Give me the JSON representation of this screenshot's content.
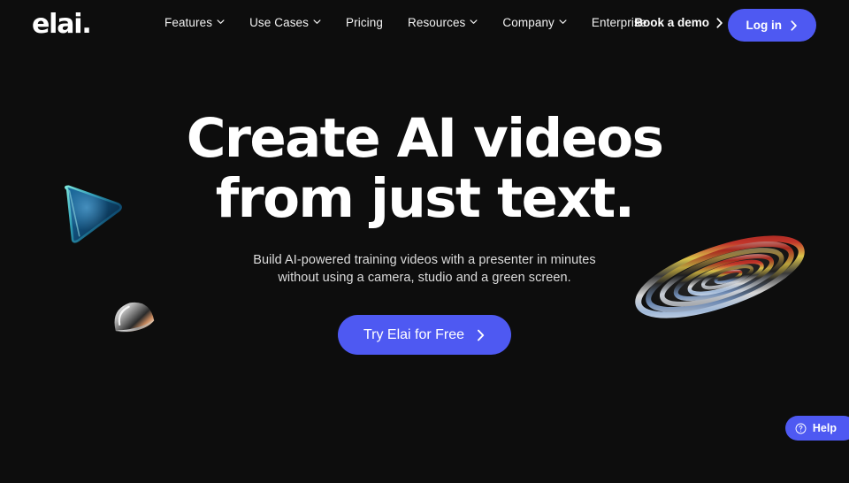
{
  "theme": {
    "background": "#0d0d0d",
    "accent": "#4e59f2",
    "text_primary": "#ffffff",
    "text_secondary": "#dcdcdc"
  },
  "navbar": {
    "logo": "elai.",
    "links": [
      {
        "label": "Features",
        "has_dropdown": true,
        "icon": "chevron-down-icon"
      },
      {
        "label": "Use Cases",
        "has_dropdown": true,
        "icon": "chevron-down-icon"
      },
      {
        "label": "Pricing",
        "has_dropdown": false,
        "icon": ""
      },
      {
        "label": "Resources",
        "has_dropdown": true,
        "icon": "chevron-down-icon"
      },
      {
        "label": "Company",
        "has_dropdown": true,
        "icon": "chevron-down-icon"
      },
      {
        "label": "Enterprise",
        "has_dropdown": false,
        "icon": ""
      }
    ],
    "book_demo": {
      "label": "Book a demo",
      "icon": "chevron-right-icon"
    },
    "login": {
      "label": "Log in",
      "icon": "chevron-right-icon"
    }
  },
  "hero": {
    "headline_line1": "Create AI videos",
    "headline_line2": "from just text.",
    "subhead_line1": "Build AI-powered training videos with a presenter in minutes",
    "subhead_line2": "without using a camera, studio and a green screen.",
    "cta": {
      "label": "Try Elai for Free",
      "icon": "chevron-right-icon"
    }
  },
  "decorations": [
    {
      "name": "blue-play-triangle",
      "colors": [
        "#0b3f66",
        "#176ea8",
        "#5fd6d0"
      ]
    },
    {
      "name": "chrome-dome",
      "colors": [
        "#e8e8e8",
        "#8a8a8a",
        "#c98a5e"
      ]
    },
    {
      "name": "iridescent-spiral",
      "colors": [
        "#d9d9d9",
        "#c9342b",
        "#d8c24a",
        "#5a7fd0"
      ]
    }
  ],
  "help_widget": {
    "label": "Help",
    "icon": "question-mark-circle-icon"
  }
}
